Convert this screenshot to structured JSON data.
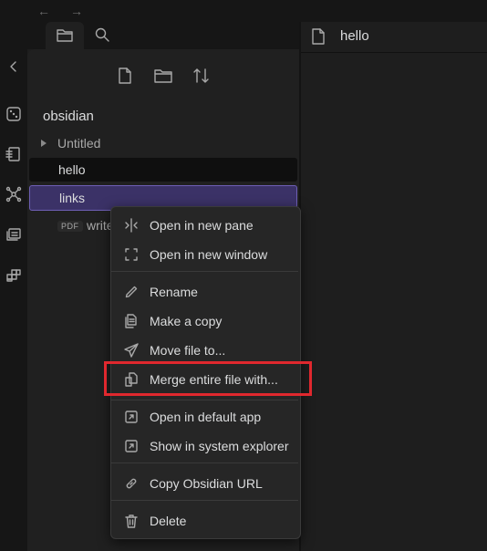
{
  "nav": {
    "back": "←",
    "forward": "→"
  },
  "ribbon": {
    "icons": [
      "collapse-icon",
      "dice-icon",
      "switcher-icon",
      "graph-icon",
      "slides-icon",
      "blocks-icon"
    ]
  },
  "sidebar": {
    "tabs": [
      {
        "name": "files-tab",
        "icon": "folder-icon"
      },
      {
        "name": "search-tab",
        "icon": "search-icon"
      }
    ],
    "toolbar": [
      "new-note-icon",
      "new-folder-icon",
      "sort-icon"
    ],
    "vault_name": "obsidian",
    "items": [
      {
        "label": "Untitled",
        "type": "folder"
      },
      {
        "label": "hello",
        "type": "file"
      },
      {
        "label": "links",
        "type": "file"
      },
      {
        "label": "write",
        "type": "pdf",
        "badge": "PDF"
      }
    ]
  },
  "pane": {
    "title": "hello"
  },
  "context_menu": {
    "groups": [
      [
        {
          "label": "Open in new pane",
          "icon": "split-icon"
        },
        {
          "label": "Open in new window",
          "icon": "window-icon"
        }
      ],
      [
        {
          "label": "Rename",
          "icon": "pencil-icon"
        },
        {
          "label": "Make a copy",
          "icon": "copy-icon"
        },
        {
          "label": "Move file to...",
          "icon": "send-icon"
        },
        {
          "label": "Merge entire file with...",
          "icon": "merge-icon"
        }
      ],
      [
        {
          "label": "Open in default app",
          "icon": "external-icon"
        },
        {
          "label": "Show in system explorer",
          "icon": "external-icon"
        }
      ],
      [
        {
          "label": "Copy Obsidian URL",
          "icon": "link-icon"
        }
      ],
      [
        {
          "label": "Delete",
          "icon": "trash-icon"
        }
      ]
    ]
  },
  "colors": {
    "highlight": "#e0282e",
    "selected": "#3b3267"
  }
}
